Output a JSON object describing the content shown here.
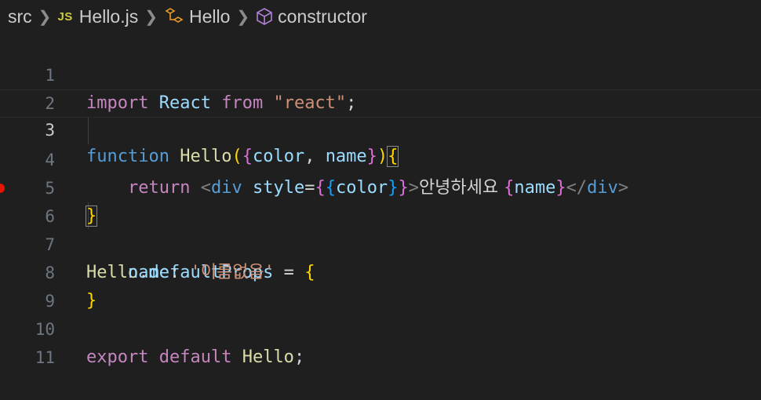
{
  "breadcrumb": {
    "folder": "src",
    "file_badge": "JS",
    "file": "Hello.js",
    "component": "Hello",
    "member": "constructor"
  },
  "editor": {
    "line_numbers": [
      "1",
      "2",
      "3",
      "4",
      "5",
      "6",
      "7",
      "8",
      "9",
      "10",
      "11"
    ],
    "current_line": 3,
    "breakpoint_line": 6,
    "line1": {
      "import": "import",
      "React": "React",
      "from": "from",
      "str": "\"react\"",
      "semi": ";"
    },
    "line3": {
      "function": "function",
      "name": "Hello",
      "p1": "(",
      "b1": "{",
      "color": "color",
      "comma": ",",
      "pname": "name",
      "b1c": "}",
      "p1c": ")",
      "open": "{"
    },
    "line4": {
      "return": "return",
      "lt": "<",
      "div": "div",
      "style": "style",
      "eq": "=",
      "b1": "{",
      "b2": "{",
      "color": "color",
      "b2c": "}",
      "b1c": "}",
      "gt": ">",
      "text": "안녕하세요 ",
      "nb": "{",
      "name": "name",
      "nbc": "}",
      "close_open": "</",
      "close_div": "div",
      "close_gt": ">"
    },
    "line5": {
      "close": "}"
    },
    "line6": {
      "obj": "Hello",
      "dot": ".",
      "prop": "defaultProps",
      "eq": " = ",
      "open": "{"
    },
    "line7": {
      "key": "name",
      "colon": ": ",
      "value": "'이름없음'"
    },
    "line8": {
      "close": "}"
    },
    "line10": {
      "export": "export",
      "default": "default",
      "name": "Hello",
      "semi": ";"
    }
  },
  "colors": {
    "background": "#1f1f1f",
    "breakpoint": "#e51400",
    "keyword_control": "#c586c0",
    "keyword": "#569cd6",
    "variable": "#9cdcfe",
    "function": "#dcdcaa",
    "string": "#ce9178"
  }
}
